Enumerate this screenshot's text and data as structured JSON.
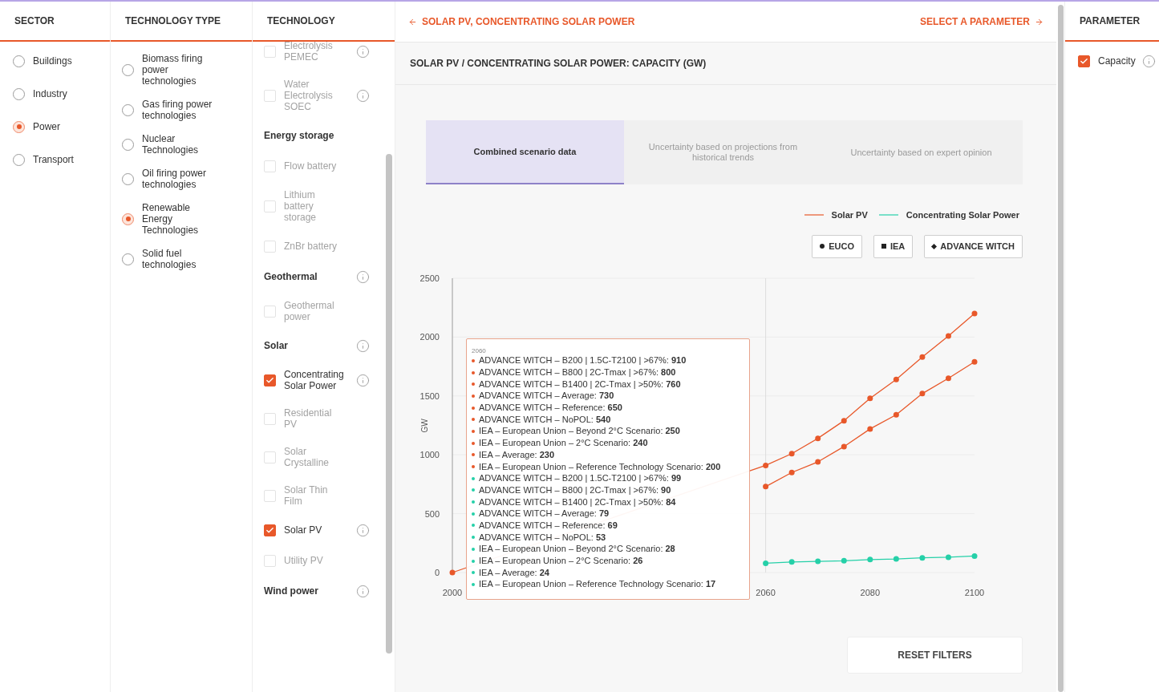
{
  "sector": {
    "title": "SECTOR",
    "options": [
      {
        "label": "Buildings",
        "selected": false
      },
      {
        "label": "Industry",
        "selected": false
      },
      {
        "label": "Power",
        "selected": true
      },
      {
        "label": "Transport",
        "selected": false
      }
    ]
  },
  "technology_type": {
    "title": "TECHNOLOGY TYPE",
    "options": [
      {
        "label": "Biomass firing power technologies",
        "selected": false
      },
      {
        "label": "Gas firing power technologies",
        "selected": false
      },
      {
        "label": "Nuclear Technologies",
        "selected": false
      },
      {
        "label": "Oil firing power technologies",
        "selected": false
      },
      {
        "label": "Renewable Energy Technologies",
        "selected": true
      },
      {
        "label": "Solid fuel technologies",
        "selected": false
      }
    ]
  },
  "technology": {
    "title": "TECHNOLOGY",
    "items": [
      {
        "kind": "item",
        "label": "Electrolysis PEMEC",
        "checked": false,
        "disabled": true,
        "info": true
      },
      {
        "kind": "item",
        "label": "Water Electrolysis SOEC",
        "checked": false,
        "disabled": true,
        "info": true
      },
      {
        "kind": "heading",
        "label": "Energy storage",
        "info": false
      },
      {
        "kind": "item",
        "label": "Flow battery",
        "checked": false,
        "disabled": true,
        "info": false
      },
      {
        "kind": "item",
        "label": "Lithium battery storage",
        "checked": false,
        "disabled": true,
        "info": false
      },
      {
        "kind": "item",
        "label": "ZnBr battery",
        "checked": false,
        "disabled": true,
        "info": false
      },
      {
        "kind": "heading",
        "label": "Geothermal",
        "info": true
      },
      {
        "kind": "item",
        "label": "Geothermal power",
        "checked": false,
        "disabled": true,
        "info": false
      },
      {
        "kind": "heading",
        "label": "Solar",
        "info": true
      },
      {
        "kind": "item",
        "label": "Concentrating Solar Power",
        "checked": true,
        "disabled": false,
        "info": true
      },
      {
        "kind": "item",
        "label": "Residential PV",
        "checked": false,
        "disabled": true,
        "info": false
      },
      {
        "kind": "item",
        "label": "Solar Crystalline",
        "checked": false,
        "disabled": true,
        "info": false
      },
      {
        "kind": "item",
        "label": "Solar Thin Film",
        "checked": false,
        "disabled": true,
        "info": false
      },
      {
        "kind": "item",
        "label": "Solar PV",
        "checked": true,
        "disabled": false,
        "info": true
      },
      {
        "kind": "item",
        "label": "Utility PV",
        "checked": false,
        "disabled": true,
        "info": false
      },
      {
        "kind": "heading",
        "label": "Wind power",
        "info": true
      }
    ]
  },
  "breadcrumb": {
    "back": "SOLAR PV, CONCENTRATING SOLAR POWER",
    "next": "SELECT A PARAMETER"
  },
  "chart_title": "SOLAR PV / CONCENTRATING SOLAR POWER: CAPACITY (GW)",
  "view_tabs": [
    {
      "label": "Combined scenario data",
      "selected": true
    },
    {
      "label": "Uncertainty based on projections from historical trends",
      "selected": false
    },
    {
      "label": "Uncertainty based on expert opinion",
      "selected": false
    }
  ],
  "source_filters": [
    {
      "label": "EUCO",
      "kind": "circle"
    },
    {
      "label": "IEA",
      "kind": "square"
    },
    {
      "label": "ADVANCE WITCH",
      "kind": "diamond"
    }
  ],
  "chart_data": {
    "type": "line",
    "ylabel": "GW",
    "xlim": [
      2000,
      2100
    ],
    "ylim": [
      0,
      2500
    ],
    "grid": true,
    "ref_lines": [
      {
        "axis": "x",
        "value": 2060
      }
    ],
    "xticks": [
      2000,
      2060,
      2080,
      2100
    ],
    "yticks": [
      0,
      500,
      1000,
      1500,
      2000,
      2500
    ],
    "x": [
      2000,
      2060,
      2065,
      2070,
      2075,
      2080,
      2085,
      2090,
      2095,
      2100
    ],
    "series": [
      {
        "name": "Solar PV",
        "color": "#e8582a",
        "marker": "circle",
        "values": [
          0,
          910,
          1010,
          1140,
          1290,
          1480,
          1640,
          1830,
          2010,
          2200
        ]
      },
      {
        "color": "#e8582a",
        "marker": "circle",
        "values": [
          null,
          730,
          850,
          940,
          1070,
          1220,
          1340,
          1520,
          1650,
          1790
        ]
      },
      {
        "name": "Concentrating Solar Power",
        "color": "#25d0a8",
        "marker": "circle",
        "values": [
          null,
          79,
          90,
          95,
          100,
          110,
          115,
          125,
          130,
          140
        ]
      }
    ]
  },
  "tooltip": {
    "title": "2060",
    "entries": [
      {
        "label": "ADVANCE WITCH – B200 | 1.5C-T2100 | >67%:",
        "value": "910",
        "color": "#e8582a"
      },
      {
        "label": "ADVANCE WITCH – B800 | 2C-Tmax | >67%:",
        "value": "800",
        "color": "#e8582a"
      },
      {
        "label": "ADVANCE WITCH – B1400 | 2C-Tmax | >50%:",
        "value": "760",
        "color": "#e8582a"
      },
      {
        "label": "ADVANCE WITCH – Average:",
        "value": "730",
        "color": "#e8582a"
      },
      {
        "label": "ADVANCE WITCH – Reference:",
        "value": "650",
        "color": "#e8582a"
      },
      {
        "label": "ADVANCE WITCH – NoPOL:",
        "value": "540",
        "color": "#e8582a"
      },
      {
        "label": "IEA – European Union – Beyond 2°C Scenario:",
        "value": "250",
        "color": "#e8582a"
      },
      {
        "label": "IEA – European Union – 2°C Scenario:",
        "value": "240",
        "color": "#e8582a"
      },
      {
        "label": "IEA – Average:",
        "value": "230",
        "color": "#e8582a"
      },
      {
        "label": "IEA – European Union – Reference Technology Scenario:",
        "value": "200",
        "color": "#e8582a"
      },
      {
        "label": "ADVANCE WITCH – B200 | 1.5C-T2100 | >67%:",
        "value": "99",
        "color": "#25d0a8"
      },
      {
        "label": "ADVANCE WITCH – B800 | 2C-Tmax | >67%:",
        "value": "90",
        "color": "#25d0a8"
      },
      {
        "label": "ADVANCE WITCH – B1400 | 2C-Tmax | >50%:",
        "value": "84",
        "color": "#25d0a8"
      },
      {
        "label": "ADVANCE WITCH – Average:",
        "value": "79",
        "color": "#25d0a8"
      },
      {
        "label": "ADVANCE WITCH – Reference:",
        "value": "69",
        "color": "#25d0a8"
      },
      {
        "label": "ADVANCE WITCH – NoPOL:",
        "value": "53",
        "color": "#25d0a8"
      },
      {
        "label": "IEA – European Union – Beyond 2°C Scenario:",
        "value": "28",
        "color": "#25d0a8"
      },
      {
        "label": "IEA – European Union – 2°C Scenario:",
        "value": "26",
        "color": "#25d0a8"
      },
      {
        "label": "IEA – Average:",
        "value": "24",
        "color": "#25d0a8"
      },
      {
        "label": "IEA – European Union – Reference Technology Scenario:",
        "value": "17",
        "color": "#25d0a8"
      }
    ]
  },
  "reset_button": "RESET FILTERS",
  "parameter": {
    "title": "PARAMETER",
    "items": [
      {
        "label": "Capacity",
        "checked": true,
        "info": true
      }
    ]
  }
}
